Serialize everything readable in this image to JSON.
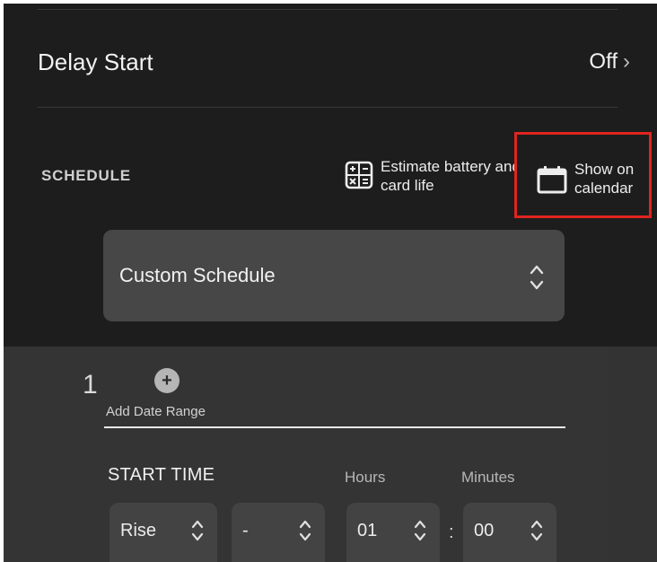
{
  "delay_start": {
    "label": "Delay Start",
    "value": "Off",
    "chevron": "›"
  },
  "schedule": {
    "section_label": "SCHEDULE",
    "estimate_label": "Estimate battery and card life",
    "estimate_icon": "calculator-icon",
    "calendar_label": "Show on calendar",
    "calendar_icon": "calendar-icon",
    "highlight_color": "#e0241f",
    "mode_value": "Custom Schedule"
  },
  "date_range": {
    "index": "1",
    "add_label": "Add Date Range",
    "add_icon": "plus-circle-icon"
  },
  "start_time": {
    "label": "START TIME",
    "hours_label": "Hours",
    "minutes_label": "Minutes",
    "event_value": "Rise",
    "offset_sign_value": "-",
    "hours_value": "01",
    "separator": ":",
    "minutes_value": "00"
  }
}
